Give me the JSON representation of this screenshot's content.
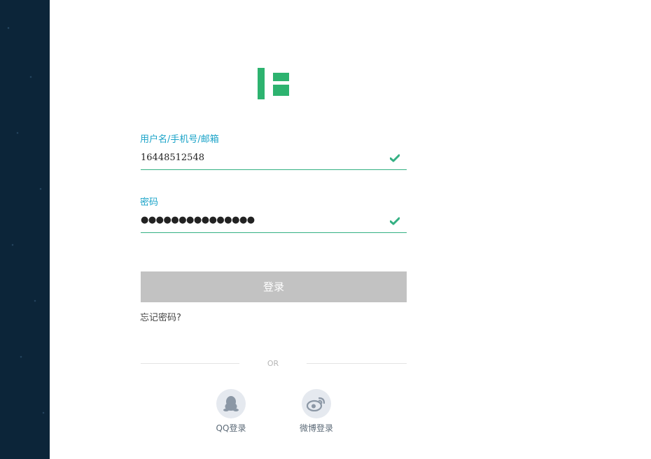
{
  "login_form": {
    "username_label": "用户名/手机号/邮箱",
    "username_value": "16448512548",
    "password_label": "密码",
    "password_value": "●●●●●●●●●●●●●●●",
    "submit_label": "登录",
    "forgot_label": "忘记密码?"
  },
  "divider": {
    "or_label": "OR"
  },
  "social_login": {
    "qq_label": "QQ登录",
    "weibo_label": "微博登录"
  },
  "colors": {
    "accent": "#2db36f",
    "label": "#1aa3c8",
    "sidebar": "#0c2539",
    "button_disabled": "#c2c2c2"
  },
  "icons": {
    "logo": "brand-logo",
    "valid": "check-icon",
    "qq": "qq-penguin-icon",
    "weibo": "weibo-icon"
  }
}
